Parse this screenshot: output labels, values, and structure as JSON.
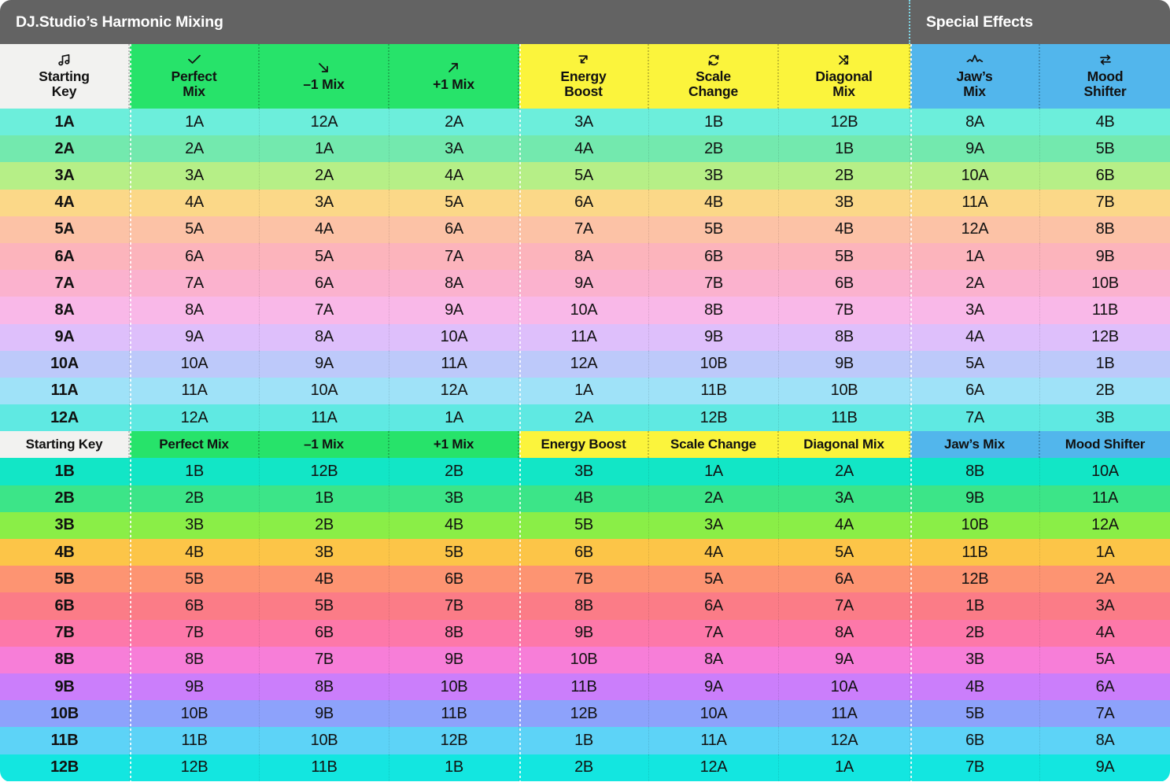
{
  "titlebar": {
    "left_title": "DJ.Studio’s Harmonic Mixing",
    "right_title": "Special Effects"
  },
  "columns": [
    {
      "key": "starting_key",
      "label_line1": "Starting",
      "label_line2": "Key",
      "short": "Starting Key",
      "icon": "music-note-icon",
      "group": "key"
    },
    {
      "key": "perfect_mix",
      "label_line1": "Perfect",
      "label_line2": "Mix",
      "short": "Perfect Mix",
      "icon": "check-icon",
      "group": "harmonic"
    },
    {
      "key": "minus_one",
      "label_line1": "–1 Mix",
      "label_line2": "",
      "short": "–1 Mix",
      "icon": "arrow-down-right-icon",
      "group": "harmonic"
    },
    {
      "key": "plus_one",
      "label_line1": "+1 Mix",
      "label_line2": "",
      "short": "+1 Mix",
      "icon": "arrow-up-right-icon",
      "group": "harmonic"
    },
    {
      "key": "energy_boost",
      "label_line1": "Energy",
      "label_line2": "Boost",
      "short": "Energy Boost",
      "icon": "arrow-up-right-corner-icon",
      "group": "energy"
    },
    {
      "key": "scale_change",
      "label_line1": "Scale",
      "label_line2": "Change",
      "short": "Scale Change",
      "icon": "refresh-cycle-icon",
      "group": "energy"
    },
    {
      "key": "diagonal_mix",
      "label_line1": "Diagonal",
      "label_line2": "Mix",
      "short": "Diagonal Mix",
      "icon": "crossed-arrows-icon",
      "group": "energy"
    },
    {
      "key": "jaws_mix",
      "label_line1": "Jaw’s",
      "label_line2": "Mix",
      "short": "Jaw’s Mix",
      "icon": "shark-fin-wave-icon",
      "group": "special"
    },
    {
      "key": "mood_shifter",
      "label_line1": "Mood",
      "label_line2": "Shifter",
      "short": "Mood Shifter",
      "icon": "swap-arrows-icon",
      "group": "special"
    }
  ],
  "group_colors": {
    "key": "#f2f2f0",
    "harmonic": "#27e36a",
    "energy": "#fbf43c",
    "special": "#52b6ec"
  },
  "rows_a": [
    {
      "color": "#6ceedb",
      "cells": [
        "1A",
        "1A",
        "12A",
        "2A",
        "3A",
        "1B",
        "12B",
        "8A",
        "4B"
      ]
    },
    {
      "color": "#73e9ae",
      "cells": [
        "2A",
        "2A",
        "1A",
        "3A",
        "4A",
        "2B",
        "1B",
        "9A",
        "5B"
      ]
    },
    {
      "color": "#b6ef87",
      "cells": [
        "3A",
        "3A",
        "2A",
        "4A",
        "5A",
        "3B",
        "2B",
        "10A",
        "6B"
      ]
    },
    {
      "color": "#fbd888",
      "cells": [
        "4A",
        "4A",
        "3A",
        "5A",
        "6A",
        "4B",
        "3B",
        "11A",
        "7B"
      ]
    },
    {
      "color": "#fcc2a6",
      "cells": [
        "5A",
        "5A",
        "4A",
        "6A",
        "7A",
        "5B",
        "4B",
        "12A",
        "8B"
      ]
    },
    {
      "color": "#fcb4bc",
      "cells": [
        "6A",
        "6A",
        "5A",
        "7A",
        "8A",
        "6B",
        "5B",
        "1A",
        "9B"
      ]
    },
    {
      "color": "#fbb2ce",
      "cells": [
        "7A",
        "7A",
        "6A",
        "8A",
        "9A",
        "7B",
        "6B",
        "2A",
        "10B"
      ]
    },
    {
      "color": "#f9b8e8",
      "cells": [
        "8A",
        "8A",
        "7A",
        "9A",
        "10A",
        "8B",
        "7B",
        "3A",
        "11B"
      ]
    },
    {
      "color": "#debffb",
      "cells": [
        "9A",
        "9A",
        "8A",
        "10A",
        "11A",
        "9B",
        "8B",
        "4A",
        "12B"
      ]
    },
    {
      "color": "#bdc9fa",
      "cells": [
        "10A",
        "10A",
        "9A",
        "11A",
        "12A",
        "10B",
        "9B",
        "5A",
        "1B"
      ]
    },
    {
      "color": "#9fe2f8",
      "cells": [
        "11A",
        "11A",
        "10A",
        "12A",
        "1A",
        "11B",
        "10B",
        "6A",
        "2B"
      ]
    },
    {
      "color": "#5fe9e2",
      "cells": [
        "12A",
        "12A",
        "11A",
        "1A",
        "2A",
        "12B",
        "11B",
        "7A",
        "3B"
      ]
    }
  ],
  "rows_b": [
    {
      "color": "#12e6c6",
      "cells": [
        "1B",
        "1B",
        "12B",
        "2B",
        "3B",
        "1A",
        "2A",
        "8B",
        "10A"
      ]
    },
    {
      "color": "#3ce588",
      "cells": [
        "2B",
        "2B",
        "1B",
        "3B",
        "4B",
        "2A",
        "3A",
        "9B",
        "11A"
      ]
    },
    {
      "color": "#8aee47",
      "cells": [
        "3B",
        "3B",
        "2B",
        "4B",
        "5B",
        "3A",
        "4A",
        "10B",
        "12A"
      ]
    },
    {
      "color": "#fcc548",
      "cells": [
        "4B",
        "4B",
        "3B",
        "5B",
        "6B",
        "4A",
        "5A",
        "11B",
        "1A"
      ]
    },
    {
      "color": "#fd9472",
      "cells": [
        "5B",
        "5B",
        "4B",
        "6B",
        "7B",
        "5A",
        "6A",
        "12B",
        "2A"
      ]
    },
    {
      "color": "#fb7c87",
      "cells": [
        "6B",
        "6B",
        "5B",
        "7B",
        "8B",
        "6A",
        "7A",
        "1B",
        "3A"
      ]
    },
    {
      "color": "#fd78a9",
      "cells": [
        "7B",
        "7B",
        "6B",
        "8B",
        "9B",
        "7A",
        "8A",
        "2B",
        "4A"
      ]
    },
    {
      "color": "#f77ed8",
      "cells": [
        "8B",
        "8B",
        "7B",
        "9B",
        "10B",
        "8A",
        "9A",
        "3B",
        "5A"
      ]
    },
    {
      "color": "#cb7efb",
      "cells": [
        "9B",
        "9B",
        "8B",
        "10B",
        "11B",
        "9A",
        "10A",
        "4B",
        "6A"
      ]
    },
    {
      "color": "#8da2fb",
      "cells": [
        "10B",
        "10B",
        "9B",
        "11B",
        "12B",
        "10A",
        "11A",
        "5B",
        "7A"
      ]
    },
    {
      "color": "#5dd3f7",
      "cells": [
        "11B",
        "11B",
        "10B",
        "12B",
        "1B",
        "11A",
        "12A",
        "6B",
        "8A"
      ]
    },
    {
      "color": "#13e6e0",
      "cells": [
        "12B",
        "12B",
        "11B",
        "1B",
        "2B",
        "12A",
        "1A",
        "7B",
        "9A"
      ]
    }
  ]
}
